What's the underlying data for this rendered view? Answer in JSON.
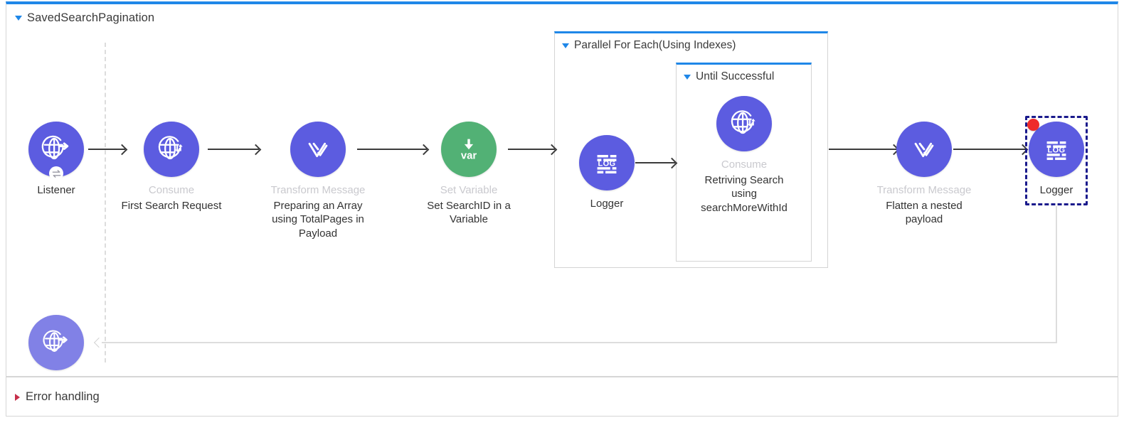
{
  "flow": {
    "title": "SavedSearchPagination",
    "toggle_icon": "caret-down-icon"
  },
  "error_section": {
    "title": "Error handling",
    "toggle_icon": "caret-right-icon"
  },
  "scopes": [
    {
      "id": "parallel-for-each",
      "title": "Parallel For Each(Using Indexes)",
      "toggle_icon": "caret-down-icon"
    },
    {
      "id": "until-successful",
      "title": "Until Successful",
      "toggle_icon": "caret-down-icon"
    }
  ],
  "nodes": [
    {
      "id": "listener",
      "type": "",
      "name": "Listener",
      "icon": "globe-arrow-out-icon",
      "color": "#5c5ce0",
      "badge": "exchange-icon"
    },
    {
      "id": "consume-1",
      "type": "Consume",
      "name": "First Search Request",
      "icon": "globe-arrows-icon",
      "color": "#5c5ce0"
    },
    {
      "id": "transform-1",
      "type": "Transform Message",
      "name": "Preparing an Array using TotalPages in Payload",
      "icon": "dataweave-icon",
      "color": "#5c5ce0"
    },
    {
      "id": "set-var",
      "type": "Set Variable",
      "name": "Set SearchID in a Variable",
      "icon": "var-down-arrow-icon",
      "color": "#52b175"
    },
    {
      "id": "logger-1",
      "type": "",
      "name": "Logger",
      "icon": "log-icon",
      "color": "#5c5ce0"
    },
    {
      "id": "consume-2",
      "type": "Consume",
      "name": "Retriving Search using searchMoreWithId",
      "icon": "globe-arrows-icon",
      "color": "#5c5ce0"
    },
    {
      "id": "transform-2",
      "type": "Transform Message",
      "name": "Flatten a nested payload",
      "icon": "dataweave-icon",
      "color": "#5c5ce0"
    },
    {
      "id": "logger-2",
      "type": "",
      "name": "Logger",
      "icon": "log-icon",
      "color": "#5c5ce0",
      "selected": true,
      "error_badge": true
    },
    {
      "id": "response",
      "type": "",
      "name": "",
      "icon": "globe-arrow-out-icon",
      "color": "#8181e6"
    }
  ],
  "colors": {
    "node_purple": "#5c5ce0",
    "node_purple_light": "#8181e6",
    "node_green": "#52b175",
    "scope_accent": "#1f87e8",
    "selection": "#1a1a8c",
    "error_dot": "#ee2b2b",
    "error_caret": "#c62f4a",
    "type_label": "#c9c9ce",
    "name_label": "#333333"
  }
}
